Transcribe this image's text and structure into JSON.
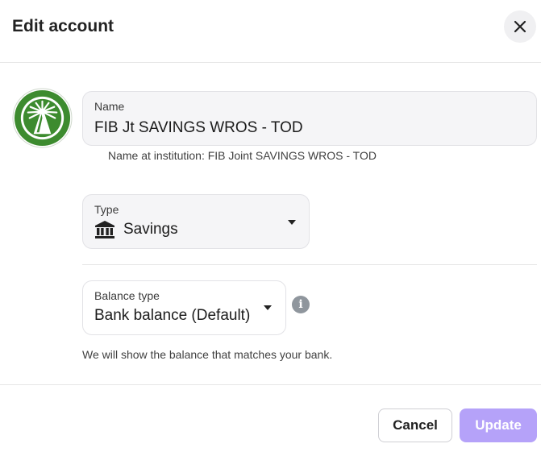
{
  "header": {
    "title": "Edit account",
    "close_icon": "close-icon"
  },
  "logo": {
    "icon": "fidelity-pyramid-logo",
    "color": "#3d8b2f"
  },
  "name_field": {
    "label": "Name",
    "value": "FIB Jt SAVINGS WROS - TOD",
    "helper": "Name at institution: FIB Joint SAVINGS WROS - TOD"
  },
  "type_field": {
    "label": "Type",
    "icon": "bank-icon",
    "value": "Savings"
  },
  "balance_field": {
    "label": "Balance type",
    "value": "Bank balance (Default)",
    "info_icon": "i",
    "helper": "We will show the balance that matches your bank."
  },
  "footer": {
    "cancel_label": "Cancel",
    "update_label": "Update",
    "update_color": "#b5a2f9"
  }
}
